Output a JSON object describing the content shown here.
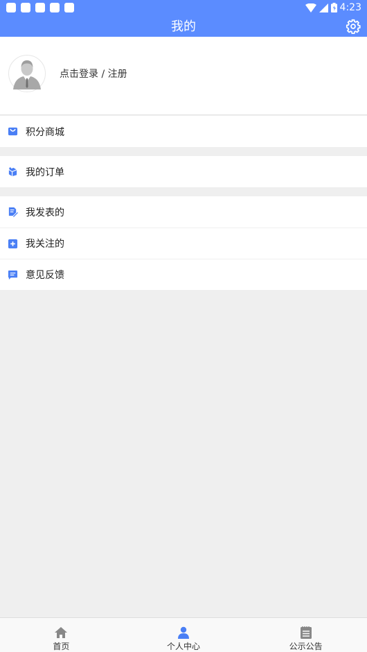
{
  "status_bar": {
    "time": "4:23"
  },
  "header": {
    "title": "我的"
  },
  "profile": {
    "login_text": "点击登录 / 注册"
  },
  "menu": {
    "points_mall": "积分商城",
    "my_orders": "我的订单",
    "my_posts": "我发表的",
    "my_follows": "我关注的",
    "feedback": "意见反馈"
  },
  "tabbar": {
    "home": "首页",
    "personal": "个人中心",
    "notice": "公示公告"
  },
  "colors": {
    "accent": "#5b8cff",
    "icon_blue": "#4a7ff5",
    "inactive": "#888888"
  }
}
